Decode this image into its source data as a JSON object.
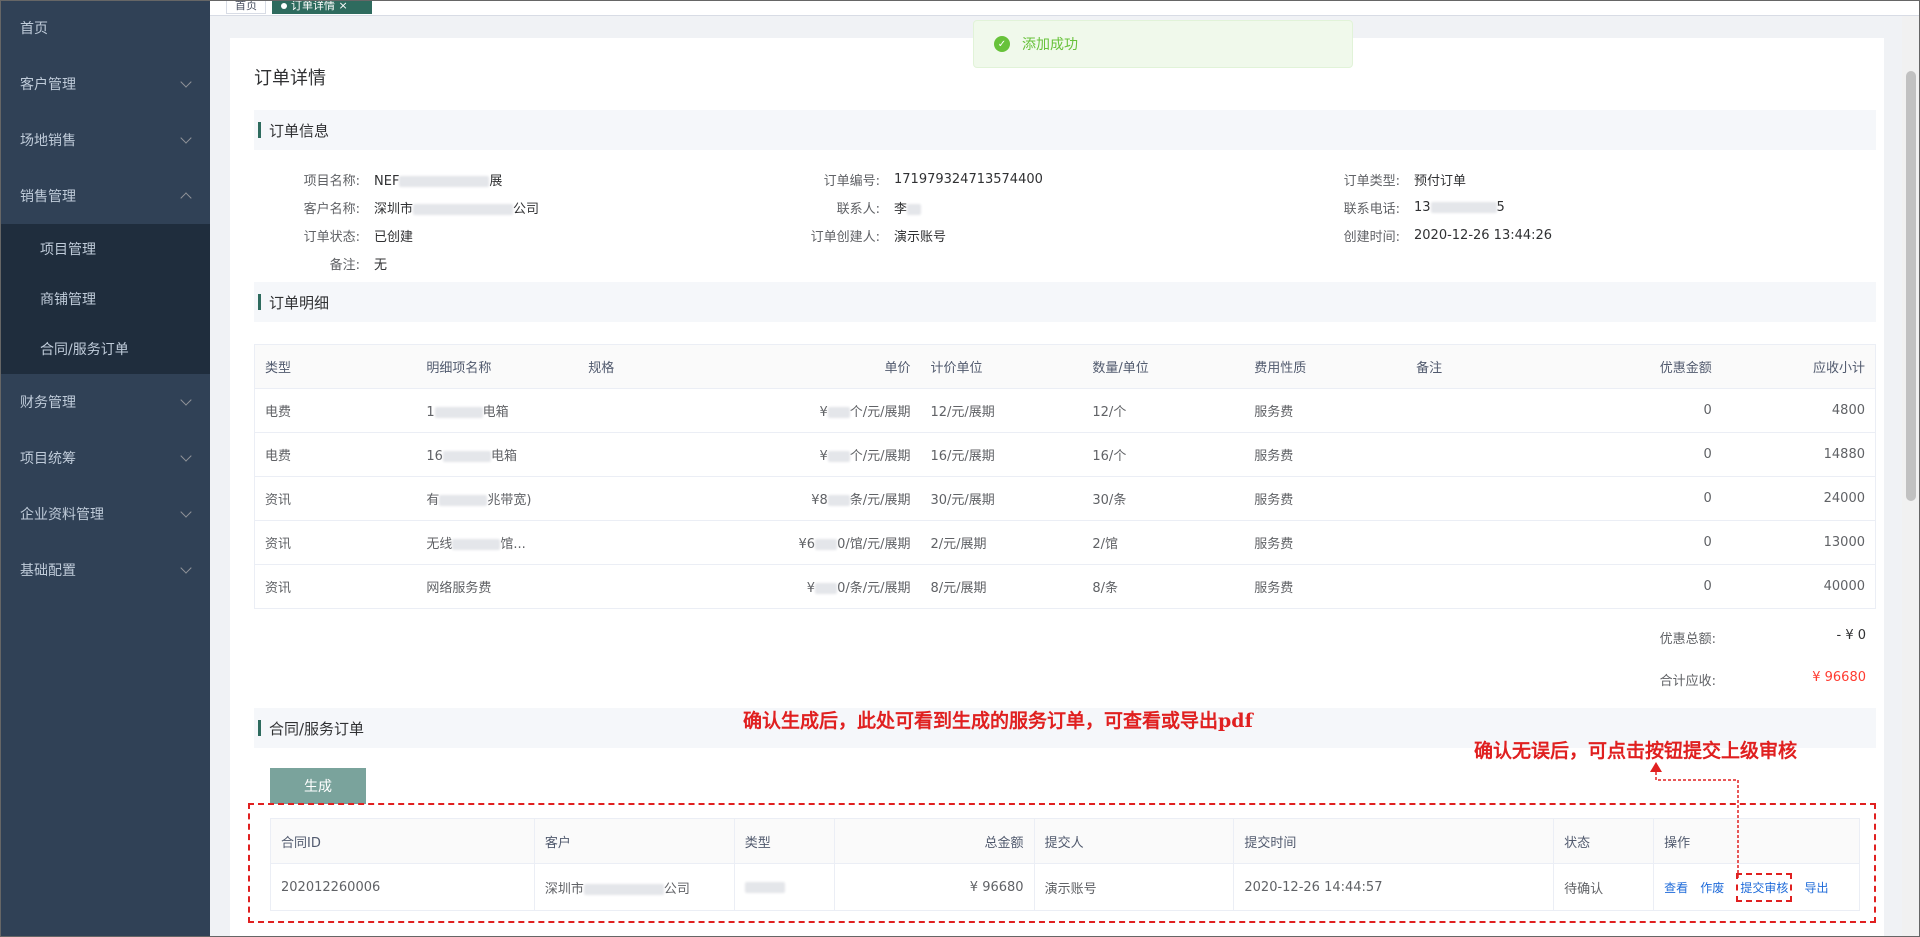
{
  "sidebar": {
    "items": [
      {
        "label": "首页",
        "has_children": false
      },
      {
        "label": "客户管理",
        "has_children": true
      },
      {
        "label": "场地销售",
        "has_children": true
      },
      {
        "label": "销售管理",
        "has_children": true,
        "expanded": true,
        "children": [
          {
            "label": "项目管理"
          },
          {
            "label": "商铺管理"
          },
          {
            "label": "合同/服务订单"
          }
        ]
      },
      {
        "label": "财务管理",
        "has_children": true
      },
      {
        "label": "项目统筹",
        "has_children": true
      },
      {
        "label": "企业资料管理",
        "has_children": true
      },
      {
        "label": "基础配置",
        "has_children": true
      }
    ]
  },
  "tags": {
    "home": "首页",
    "active": "订单详情",
    "close": "×"
  },
  "toast": {
    "message": "添加成功",
    "color": "#67c23a"
  },
  "page": {
    "title": "订单详情"
  },
  "order_info": {
    "section_title": "订单信息",
    "project_name": {
      "label": "项目名称:",
      "prefix": "NEF",
      "suffix": "展"
    },
    "order_no": {
      "label": "订单编号:",
      "value": "171979324713574400"
    },
    "order_type": {
      "label": "订单类型:",
      "value": "预付订单"
    },
    "customer_name": {
      "label": "客户名称:",
      "prefix": "深圳市",
      "suffix": "公司"
    },
    "contact": {
      "label": "联系人:",
      "prefix": "李"
    },
    "phone": {
      "label": "联系电话:",
      "prefix": "13",
      "suffix": "5"
    },
    "order_status": {
      "label": "订单状态:",
      "value": "已创建"
    },
    "creator": {
      "label": "订单创建人:",
      "value": "演示账号"
    },
    "created_at": {
      "label": "创建时间:",
      "value": "2020-12-26 13:44:26"
    },
    "remark": {
      "label": "备注:",
      "value": "无"
    }
  },
  "order_detail": {
    "section_title": "订单明细",
    "columns": [
      "类型",
      "明细项名称",
      "规格",
      "单价",
      "计价单位",
      "数量/单位",
      "费用性质",
      "备注",
      "优惠金额",
      "应收小计"
    ],
    "rows": [
      {
        "type": "电费",
        "name_prefix": "1",
        "name_suffix": "电箱",
        "price_prefix": "¥",
        "price_suffix": "个/元/展期",
        "unit": "12/元/展期",
        "qty": "12/个",
        "nature": "服务费",
        "remark": "",
        "discount": "0",
        "subtotal": "4800"
      },
      {
        "type": "电费",
        "name_prefix": "16",
        "name_suffix": "电箱",
        "price_prefix": "¥",
        "price_suffix": "个/元/展期",
        "unit": "16/元/展期",
        "qty": "16/个",
        "nature": "服务费",
        "remark": "",
        "discount": "0",
        "subtotal": "14880"
      },
      {
        "type": "资讯",
        "name_prefix": "有",
        "name_suffix": "兆带宽)",
        "price_prefix": "¥8",
        "price_suffix": "条/元/展期",
        "unit": "30/元/展期",
        "qty": "30/条",
        "nature": "服务费",
        "remark": "",
        "discount": "0",
        "subtotal": "24000"
      },
      {
        "type": "资讯",
        "name_prefix": "无线",
        "name_suffix": "馆...",
        "price_prefix": "¥6",
        "price_suffix": "0/馆/元/展期",
        "unit": "2/元/展期",
        "qty": "2/馆",
        "nature": "服务费",
        "remark": "",
        "discount": "0",
        "subtotal": "13000"
      },
      {
        "type": "资讯",
        "name_prefix": "网络服务费",
        "name_suffix": "",
        "price_prefix": "¥",
        "price_suffix": "0/条/元/展期",
        "unit": "8/元/展期",
        "qty": "8/条",
        "nature": "服务费",
        "remark": "",
        "discount": "0",
        "subtotal": "40000"
      }
    ]
  },
  "summary": {
    "discount_label": "优惠总额:",
    "discount_value": "- ¥ 0",
    "total_label": "合计应收:",
    "total_value": "¥ 96680",
    "total_color": "#ff3b30"
  },
  "contract": {
    "section_title": "合同/服务订单",
    "generate_label": "生成",
    "columns": [
      "合同ID",
      "客户",
      "类型",
      "总金额",
      "提交人",
      "提交时间",
      "状态",
      "操作"
    ],
    "rows": [
      {
        "id": "202012260006",
        "customer_prefix": "深圳市",
        "customer_suffix": "公司",
        "amount": "¥ 96680",
        "submitter": "演示账号",
        "submit_time": "2020-12-26 14:44:57",
        "status": "待确认",
        "ops": {
          "view": "查看",
          "void": "作废",
          "submit": "提交审核",
          "export": "导出"
        }
      }
    ]
  },
  "annotations": {
    "main": "确认生成后，此处可看到生成的服务订单，可查看或导出pdf",
    "submit": "确认无误后，可点击按钮提交上级审核",
    "color": "#e02020"
  },
  "colors": {
    "sidebar_bg": "#304156",
    "submenu_bg": "#1f2d3d",
    "accent": "#2e6b5e",
    "link": "#1f6bd9"
  }
}
